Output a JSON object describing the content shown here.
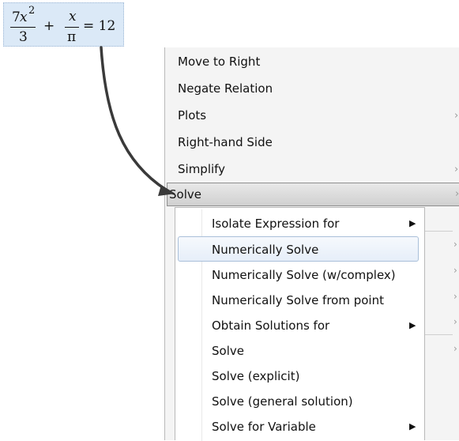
{
  "equation": {
    "num_coef": "7",
    "num_var": "x",
    "num_exp": "2",
    "den_left": "3",
    "plus": "+",
    "num_right": "x",
    "den_right": "π",
    "equals": "= 12"
  },
  "context_menu": {
    "items": [
      {
        "label": "Move to Right",
        "submenu": false
      },
      {
        "label": "Negate Relation",
        "submenu": false
      },
      {
        "label": "Plots",
        "submenu": true
      },
      {
        "label": "Right-hand Side",
        "submenu": false
      },
      {
        "label": "Simplify",
        "submenu": true
      },
      {
        "label": "Solve",
        "submenu": true,
        "selected": true
      }
    ],
    "submenu_glyph": "›"
  },
  "solve_submenu": {
    "items": [
      {
        "label": "Isolate Expression for",
        "submenu": true
      },
      {
        "label": "Numerically Solve",
        "hover": true
      },
      {
        "label": "Numerically Solve (w/complex)"
      },
      {
        "label": "Numerically Solve from point"
      },
      {
        "label": "Obtain Solutions for",
        "submenu": true
      },
      {
        "label": "Solve"
      },
      {
        "label": "Solve (explicit)"
      },
      {
        "label": "Solve (general solution)"
      },
      {
        "label": "Solve for Variable",
        "submenu": true
      }
    ],
    "submenu_glyph": "▶"
  }
}
